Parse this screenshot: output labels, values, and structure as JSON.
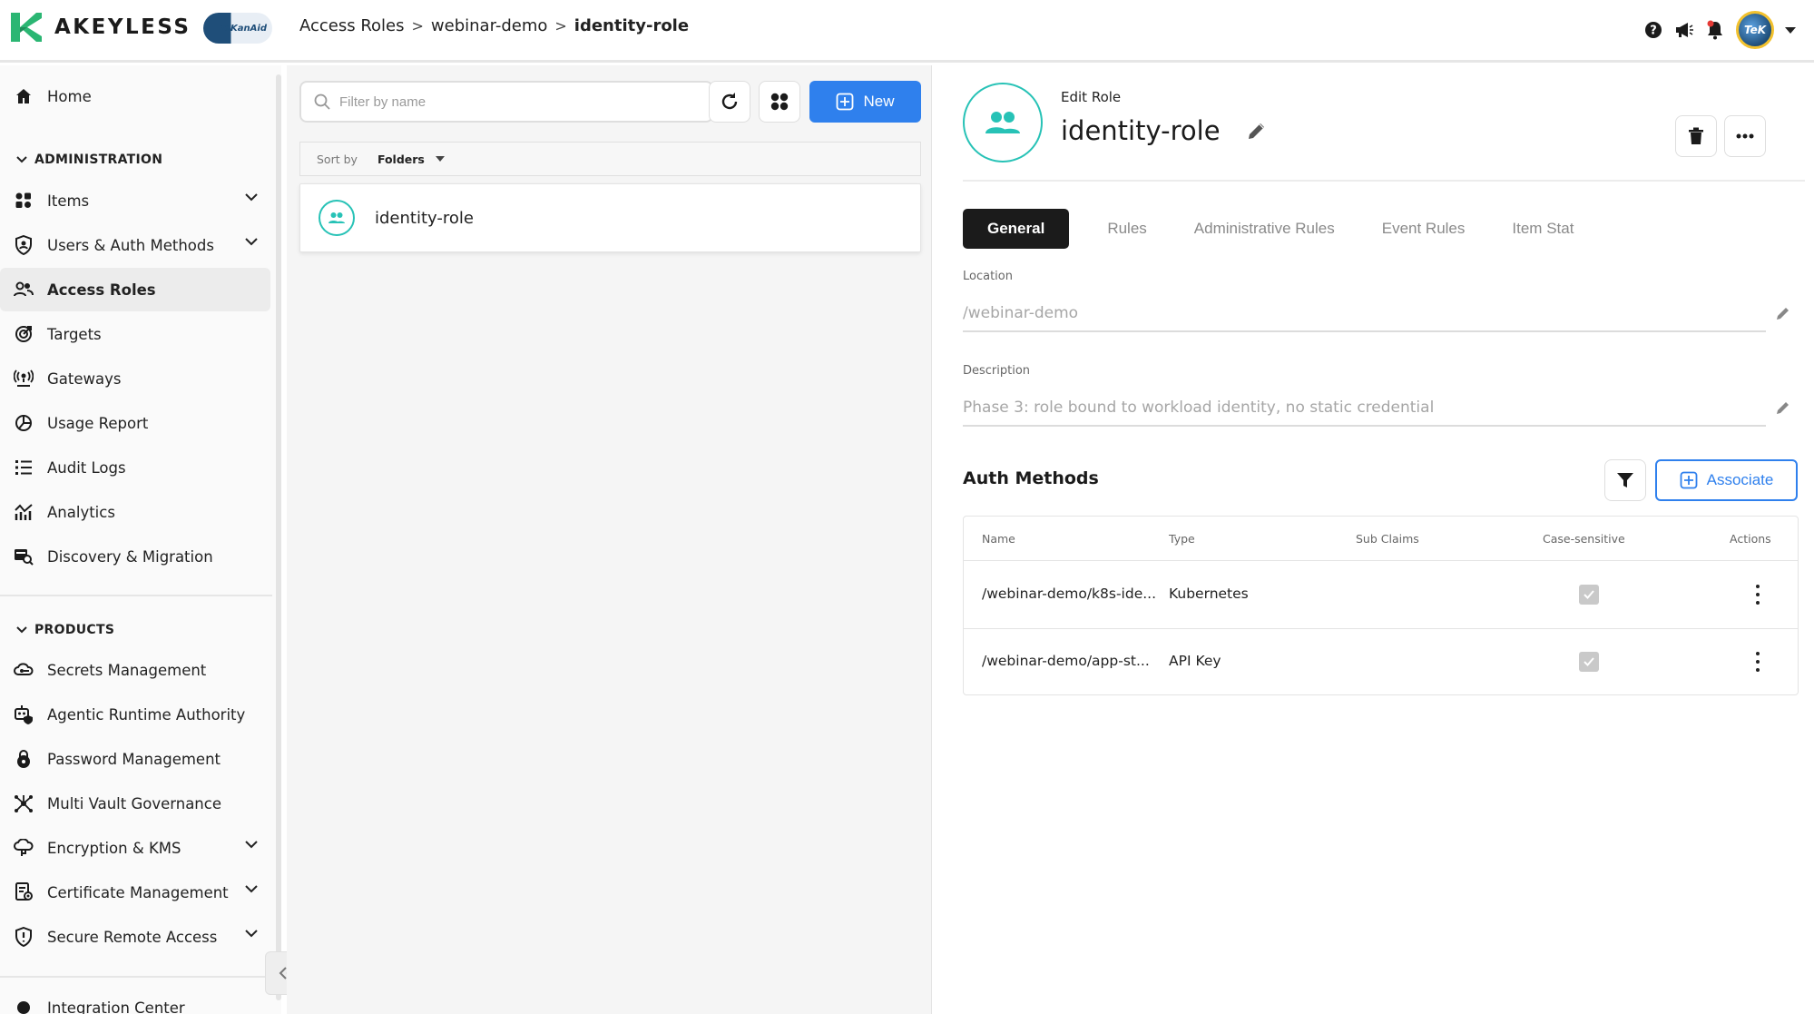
{
  "app": {
    "brand": "AKEYLESS",
    "partner_logo_text": "TeKanAid"
  },
  "breadcrumb": [
    "Access Roles",
    "webinar-demo",
    "identity-role"
  ],
  "topbar_icons": [
    "help-icon",
    "announcement-icon",
    "notifications-icon",
    "user-avatar"
  ],
  "sidebar": {
    "home": "Home",
    "admin_header": "ADMINISTRATION",
    "admin_items": [
      {
        "label": "Items",
        "icon": "items-icon",
        "expandable": true
      },
      {
        "label": "Users & Auth Methods",
        "icon": "shield-user-icon",
        "expandable": true
      },
      {
        "label": "Access Roles",
        "icon": "people-icon",
        "active": true
      },
      {
        "label": "Targets",
        "icon": "target-icon"
      },
      {
        "label": "Gateways",
        "icon": "gateway-icon"
      },
      {
        "label": "Usage Report",
        "icon": "pie-chart-icon"
      },
      {
        "label": "Audit Logs",
        "icon": "list-icon"
      },
      {
        "label": "Analytics",
        "icon": "analytics-icon"
      },
      {
        "label": "Discovery & Migration",
        "icon": "discovery-icon"
      }
    ],
    "products_header": "PRODUCTS",
    "product_items": [
      {
        "label": "Secrets Management",
        "icon": "key-cloud-icon"
      },
      {
        "label": "Agentic Runtime Authority",
        "icon": "robot-shield-icon"
      },
      {
        "label": "Password Management",
        "icon": "lock-icon"
      },
      {
        "label": "Multi Vault Governance",
        "icon": "network-icon"
      },
      {
        "label": "Encryption & KMS",
        "icon": "cloud-key-icon",
        "expandable": true
      },
      {
        "label": "Certificate Management",
        "icon": "certificate-icon",
        "expandable": true
      },
      {
        "label": "Secure Remote Access",
        "icon": "remote-shield-icon",
        "expandable": true
      }
    ],
    "integration": "Integration Center"
  },
  "list_panel": {
    "search_placeholder": "Filter by name",
    "new_label": "New",
    "sort_label": "Sort by",
    "sort_value": "Folders",
    "items": [
      "identity-role"
    ]
  },
  "detail": {
    "header_caption": "Edit Role",
    "role_name": "identity-role",
    "tabs": [
      "General",
      "Rules",
      "Administrative Rules",
      "Event Rules",
      "Item Stat"
    ],
    "active_tab": "General",
    "location_label": "Location",
    "location_value": "/webinar-demo",
    "description_label": "Description",
    "description_value": "Phase 3: role bound to workload identity, no static credential",
    "auth_methods_title": "Auth Methods",
    "associate_label": "Associate",
    "table": {
      "columns": [
        "Name",
        "Type",
        "Sub Claims",
        "Case-sensitive",
        "Actions"
      ],
      "rows": [
        {
          "name": "/webinar-demo/k8s-ide...",
          "type": "Kubernetes",
          "sub_claims": "",
          "case_sensitive": true
        },
        {
          "name": "/webinar-demo/app-st...",
          "type": "API Key",
          "sub_claims": "",
          "case_sensitive": true
        }
      ]
    }
  },
  "colors": {
    "accent_blue": "#2f80ed",
    "role_teal": "#27c2b6",
    "active_tab_bg": "#1b1b1b",
    "logo_green": "#2bb673"
  }
}
